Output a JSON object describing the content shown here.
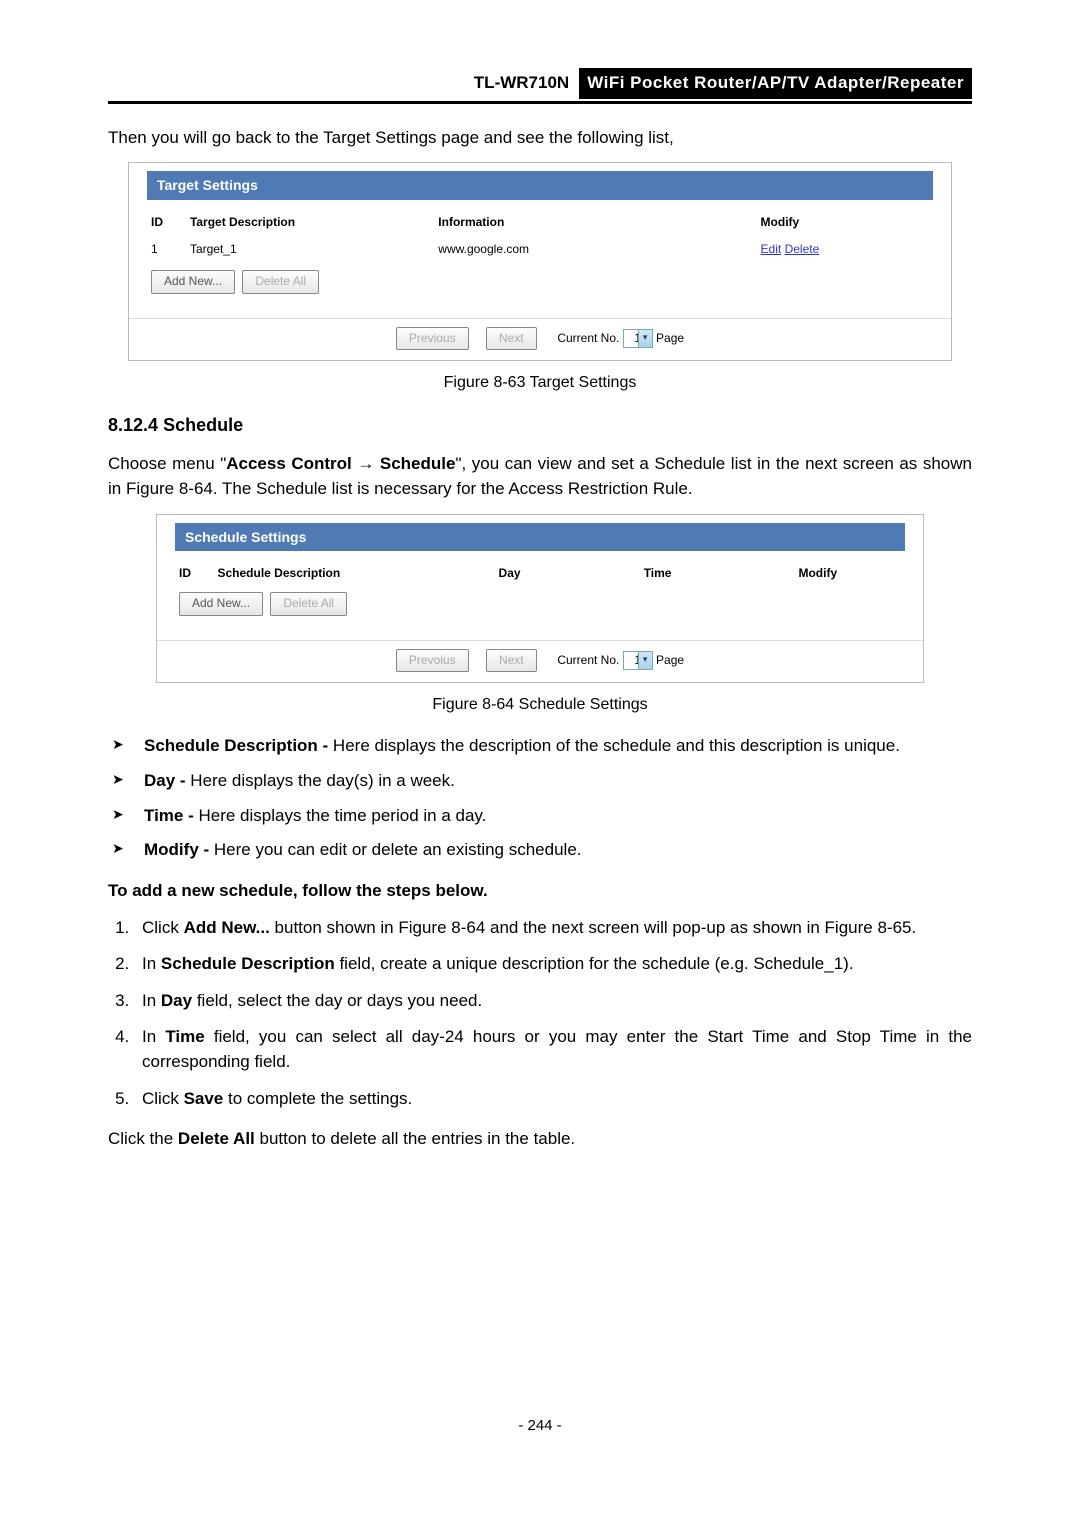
{
  "header": {
    "model": "TL-WR710N",
    "title": "WiFi  Pocket  Router/AP/TV  Adapter/Repeater"
  },
  "intro_para": "Then you will go back to the Target Settings page and see the following list,",
  "target_box": {
    "title": "Target Settings",
    "cols": {
      "id": "ID",
      "desc": "Target Description",
      "info": "Information",
      "mod": "Modify"
    },
    "row": {
      "id": "1",
      "desc": "Target_1",
      "info": "www.google.com",
      "edit": "Edit",
      "delete": "Delete"
    },
    "add_new": "Add New...",
    "delete_all": "Delete All",
    "prev": "Previous",
    "next": "Next",
    "current_no": "Current No.",
    "page_val": "1",
    "page": "Page"
  },
  "fig1": "Figure 8-63   Target Settings",
  "section_num": "8.12.4",
  "section_title": "Schedule",
  "schedule_intro1": "Choose menu \"",
  "schedule_intro2": "Access Control",
  "schedule_intro3": "  →  ",
  "schedule_intro4": "Schedule",
  "schedule_intro5": "\", you can view and set a Schedule list in the next screen as shown in Figure 8-64. The Schedule list is necessary for the Access Restriction Rule.",
  "schedule_box": {
    "title": "Schedule Settings",
    "cols": {
      "id": "ID",
      "desc": "Schedule Description",
      "day": "Day",
      "time": "Time",
      "mod": "Modify"
    },
    "add_new": "Add New...",
    "delete_all": "Delete All",
    "prev": "Prevoius",
    "next": "Next",
    "current_no": "Current No.",
    "page_val": "1",
    "page": "Page"
  },
  "fig2": "Figure 8-64   Schedule Settings",
  "bullets": {
    "b1_label": "Schedule Description -",
    "b1_text": " Here displays the description of the schedule and this description is unique.",
    "b2_label": "Day -",
    "b2_text": " Here displays the day(s) in a week.",
    "b3_label": "Time -",
    "b3_text": " Here displays the time period in a day.",
    "b4_label": "Modify -",
    "b4_text": " Here you can edit or delete an existing schedule."
  },
  "to_add": "To add a new schedule, follow the steps below.",
  "steps": {
    "s1a": "Click ",
    "s1b": "Add New...",
    "s1c": " button shown in Figure 8-64 and the next screen will pop-up as shown in Figure 8-65.",
    "s2a": "In  ",
    "s2b": "Schedule  Description",
    "s2c": "  field,  create  a  unique  description  for  the  schedule  (e.g. Schedule_1).",
    "s3a": "In ",
    "s3b": "Day",
    "s3c": " field, select the day or days you need.",
    "s4a": "In ",
    "s4b": "Time",
    "s4c": " field, you can select all day-24 hours or you may enter the Start Time and Stop Time in the corresponding field.",
    "s5a": "Click ",
    "s5b": "Save",
    "s5c": " to complete the settings."
  },
  "outro1": "Click the ",
  "outro2": "Delete All",
  "outro3": " button to delete all the entries in the table.",
  "page_num": "- 244 -"
}
